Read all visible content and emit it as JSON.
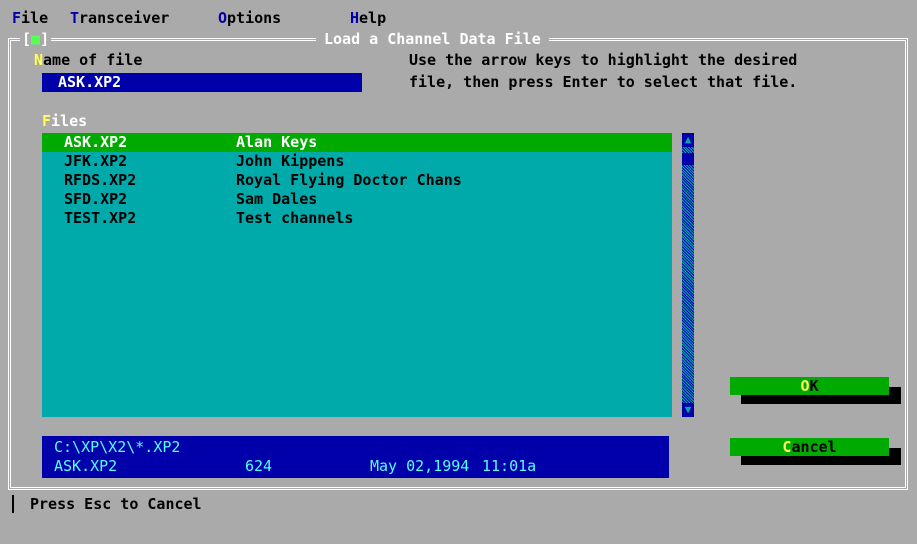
{
  "menu": {
    "items": [
      {
        "hot": "F",
        "rest": "ile"
      },
      {
        "hot": "T",
        "rest": "ransceiver"
      },
      {
        "hot": "O",
        "rest": "ptions"
      },
      {
        "hot": "H",
        "rest": "elp"
      }
    ]
  },
  "dialog": {
    "title": "Load a Channel Data File",
    "close_glyph": "■",
    "name_label_hot": "N",
    "name_label_rest": "ame of file",
    "name_value": "ASK.XP2",
    "instructions_line1": "Use the arrow keys to highlight the desired",
    "instructions_line2": "file, then press Enter to select that file.",
    "files_label_hot": "F",
    "files_label_rest": "iles",
    "files": [
      {
        "name": "ASK.XP2",
        "desc": "Alan Keys",
        "selected": true
      },
      {
        "name": "JFK.XP2",
        "desc": "John Kippens",
        "selected": false
      },
      {
        "name": "RFDS.XP2",
        "desc": "Royal Flying Doctor Chans",
        "selected": false
      },
      {
        "name": "SFD.XP2",
        "desc": "Sam Dales",
        "selected": false
      },
      {
        "name": "TEST.XP2",
        "desc": "Test channels",
        "selected": false
      }
    ],
    "info_path": "C:\\XP\\X2\\*.XP2",
    "info_file": "ASK.XP2",
    "info_size": "624",
    "info_date": "May 02,1994",
    "info_time": "11:01a",
    "ok_hot": "O",
    "ok_rest": "K",
    "cancel_hot": "C",
    "cancel_rest": "ancel"
  },
  "status": {
    "text": "Press Esc to Cancel"
  },
  "colors": {
    "background": "#aaaaaa",
    "list": "#00aaaa",
    "selected": "#00aa00",
    "input": "#0000aa",
    "hotkey": "#ffff55"
  }
}
